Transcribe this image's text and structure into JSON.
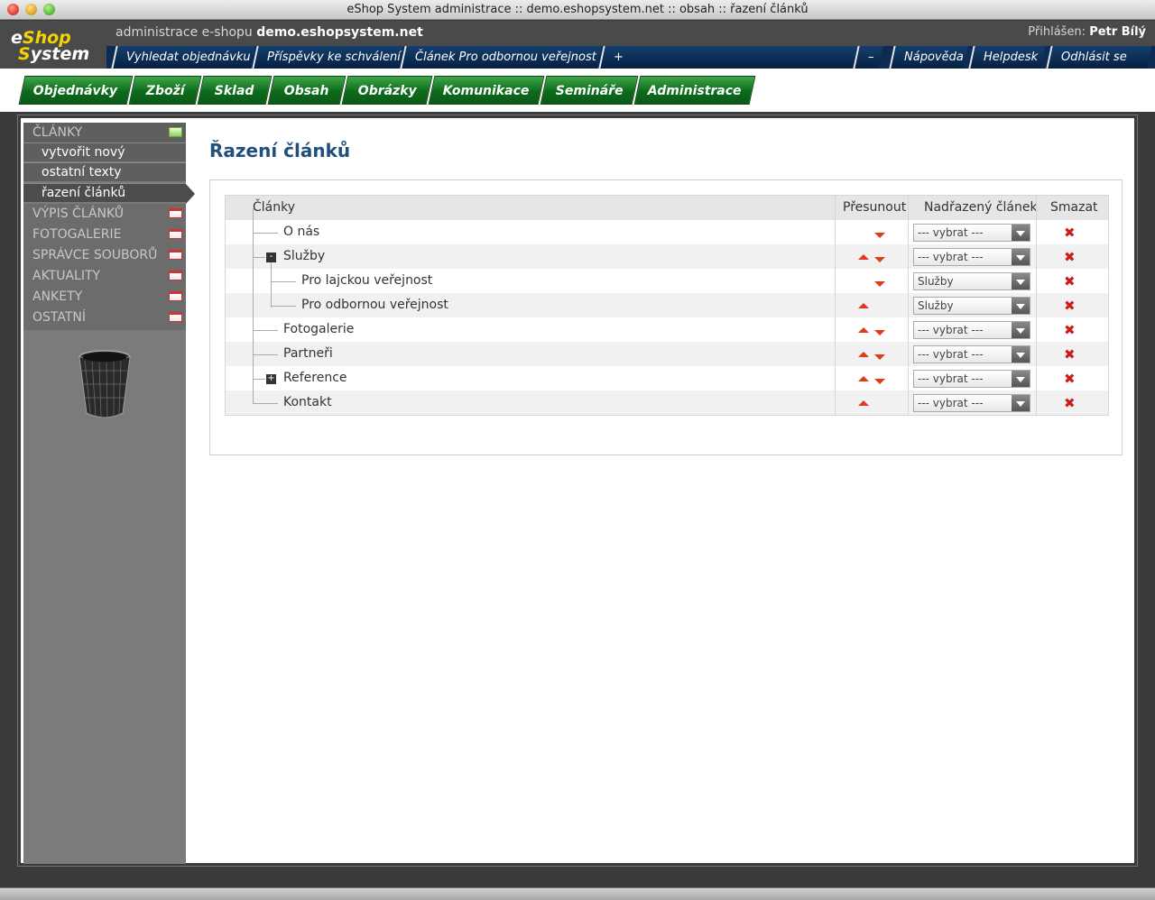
{
  "window": {
    "title": "eShop System administrace :: demo.eshopsystem.net :: obsah :: řazení článků"
  },
  "header": {
    "logo_line1a": "e",
    "logo_line1b": "Shop",
    "logo_line2a": "S",
    "logo_line2b": "ystem",
    "caption_prefix": "administrace e-shopu",
    "caption_domain": "demo.eshopsystem.net",
    "logged_label": "Přihlášen:",
    "logged_user": "Petr Bílý"
  },
  "quickbar": {
    "items": [
      "Vyhledat objednávku",
      "Příspěvky ke schválení",
      "Článek Pro odbornou veřejnost",
      "+"
    ],
    "right": [
      "–",
      "Nápověda",
      "Helpdesk",
      "Odhlásit se"
    ]
  },
  "menu": {
    "items": [
      "Objednávky",
      "Zboží",
      "Sklad",
      "Obsah",
      "Obrázky",
      "Komunikace",
      "Semináře",
      "Administrace"
    ]
  },
  "sidebar": {
    "section_active": "ČLÁNKY",
    "subitems": [
      "vytvořit nový",
      "ostatní texty",
      "řazení článků"
    ],
    "sections": [
      "VÝPIS ČLÁNKŮ",
      "FOTOGALERIE",
      "SPRÁVCE SOUBORŮ",
      "AKTUALITY",
      "ANKETY",
      "OSTATNÍ"
    ]
  },
  "main": {
    "title": "Řazení článků",
    "columns": [
      "Články",
      "Přesunout",
      "Nadřazený článek",
      "Smazat"
    ],
    "rows": [
      {
        "name": "O nás",
        "parent": "--- vybrat ---"
      },
      {
        "name": "Služby",
        "parent": "--- vybrat ---",
        "toggle": "-"
      },
      {
        "name": "Pro lajckou veřejnost",
        "parent": "Služby"
      },
      {
        "name": "Pro odbornou veřejnost",
        "parent": "Služby"
      },
      {
        "name": "Fotogalerie",
        "parent": "--- vybrat ---"
      },
      {
        "name": "Partneři",
        "parent": "--- vybrat ---"
      },
      {
        "name": "Reference",
        "parent": "--- vybrat ---",
        "toggle": "+"
      },
      {
        "name": "Kontakt",
        "parent": "--- vybrat ---"
      }
    ],
    "delete_glyph": "✖"
  }
}
